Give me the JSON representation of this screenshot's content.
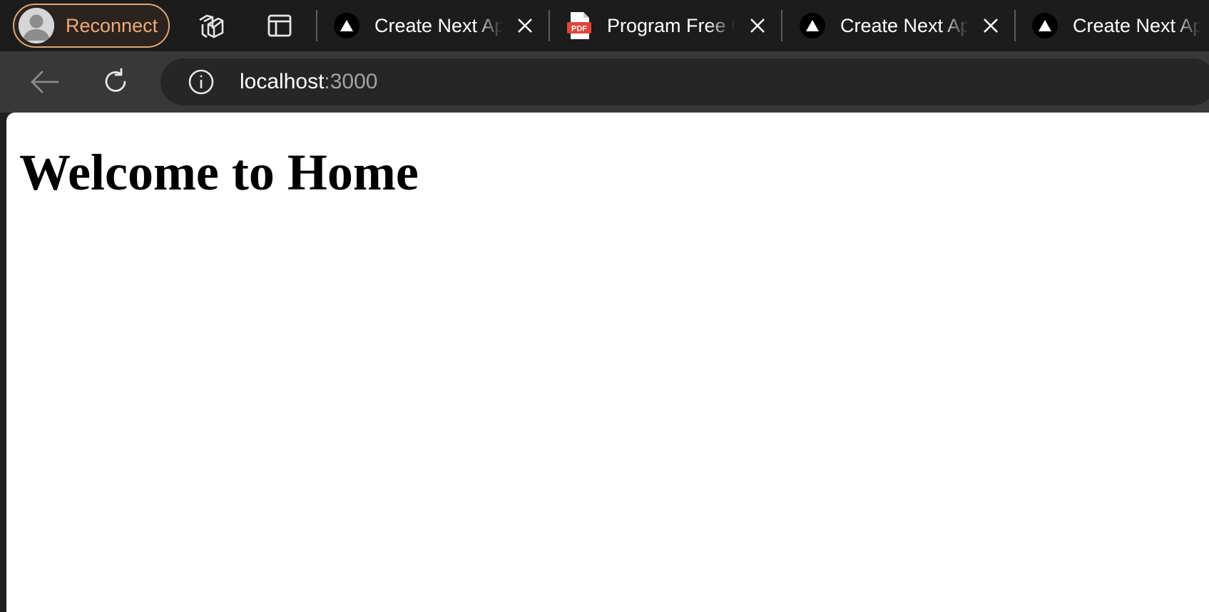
{
  "profile": {
    "label": "Reconnect"
  },
  "tabs": [
    {
      "title": "Create Next App",
      "favicon": "nextjs-triangle-icon"
    },
    {
      "title": "Program Free Guide",
      "favicon": "pdf-icon"
    },
    {
      "title": "Create Next App",
      "favicon": "nextjs-triangle-icon"
    },
    {
      "title": "Create Next App",
      "favicon": "nextjs-triangle-icon"
    }
  ],
  "pdf_badge": "PDF",
  "address_bar": {
    "host": "localhost",
    "port": ":3000"
  },
  "page": {
    "heading": "Welcome to Home"
  },
  "colors": {
    "profile_accent": "#f0ab74",
    "tabstrip_bg": "#1c1c1c",
    "toolbar_bg": "#383838",
    "omnibox_bg": "#262626"
  }
}
